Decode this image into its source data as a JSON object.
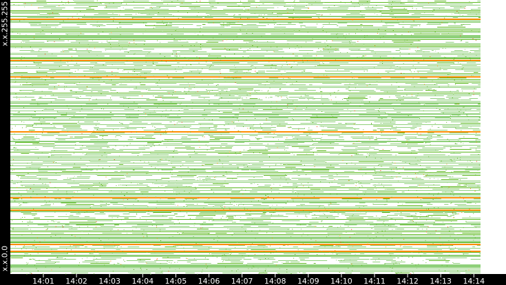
{
  "chart_data": {
    "type": "heatmap",
    "title": "",
    "xlabel": "",
    "ylabel": "",
    "y_tick_labels": [
      "x.x.255.255",
      "x.x.0.0"
    ],
    "x_tick_labels": [
      "14:01",
      "14:02",
      "14:03",
      "14:04",
      "14:05",
      "14:06",
      "14:07",
      "14:08",
      "14:09",
      "14:10",
      "14:11",
      "14:12",
      "14:13",
      "14:14"
    ],
    "x_range_minutes": [
      14.0,
      14.23
    ],
    "colors": {
      "low": "#8fd07a",
      "mid": "#5cb81e",
      "high": "#ff8c00",
      "peak": "#ff3300",
      "background": "#ffffff",
      "frame": "#000000"
    },
    "legend": "none",
    "grid": false
  }
}
